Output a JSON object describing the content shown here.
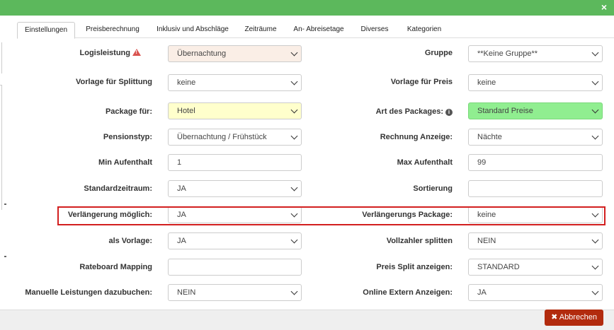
{
  "close_label": "×",
  "tabs": [
    {
      "label": "Einstellungen",
      "active": true
    },
    {
      "label": "Preisberechnung"
    },
    {
      "label": "Inklusiv und Abschläge"
    },
    {
      "label": "Zeiträume"
    },
    {
      "label": "An- Abreisetage"
    },
    {
      "label": "Diverses"
    },
    {
      "label": "Kategorien"
    }
  ],
  "left": [
    {
      "label": "Logisleistung",
      "value": "Übernachtung",
      "type": "select"
    },
    {
      "label": "Vorlage für Splittung",
      "value": "keine",
      "type": "select"
    },
    {
      "label": "Package für:",
      "value": "Hotel",
      "type": "select"
    },
    {
      "label": "Pensionstyp:",
      "value": "Übernachtung / Frühstück",
      "type": "select"
    },
    {
      "label": "Min Aufenthalt",
      "value": "1",
      "type": "input"
    },
    {
      "label": "Standardzeitraum:",
      "value": "JA",
      "type": "select"
    },
    {
      "label": "Verlängerung möglich:",
      "value": "JA",
      "type": "select"
    },
    {
      "label": "als Vorlage:",
      "value": "JA",
      "type": "select"
    },
    {
      "label": "Rateboard Mapping",
      "value": "",
      "type": "input"
    },
    {
      "label": "Manuelle Leistungen dazubuchen:",
      "value": "NEIN",
      "type": "select"
    }
  ],
  "right": [
    {
      "label": "Gruppe",
      "value": "**Keine Gruppe**",
      "type": "select"
    },
    {
      "label": "Vorlage für Preis",
      "value": "keine",
      "type": "select"
    },
    {
      "label": "Art des Packages:",
      "value": "Standard Preise",
      "type": "select"
    },
    {
      "label": "Rechnung Anzeige:",
      "value": "Nächte",
      "type": "select"
    },
    {
      "label": "Max Aufenthalt",
      "value": "99",
      "type": "input"
    },
    {
      "label": "Sortierung",
      "value": "",
      "type": "input"
    },
    {
      "label": "Verlängerungs Package:",
      "value": "keine",
      "type": "select"
    },
    {
      "label": "Vollzahler splitten",
      "value": "NEIN",
      "type": "select"
    },
    {
      "label": "Preis Split anzeigen:",
      "value": "STANDARD",
      "type": "select"
    },
    {
      "label": "Online Extern Anzeigen:",
      "value": "JA",
      "type": "select"
    }
  ],
  "cancel_label": "✖ Abbrechen",
  "colors": {
    "header": "#5cb85c",
    "logis_bg": "#faeee6",
    "package_bg": "#ffffcc",
    "art_bg": "#90ee90",
    "cancel": "#b22b0e",
    "highlight": "#d21f1f"
  }
}
